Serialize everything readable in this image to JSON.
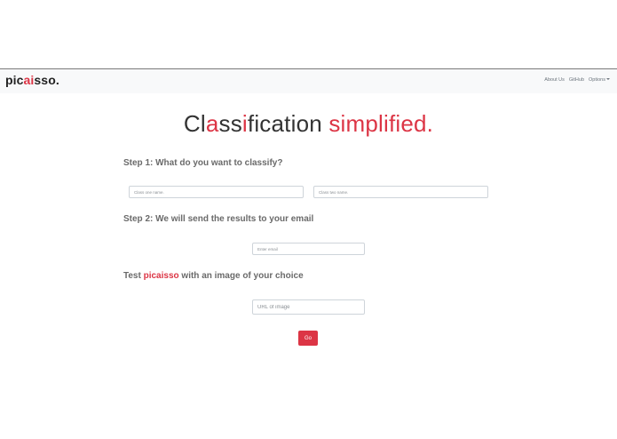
{
  "navbar": {
    "brand_prefix": "pic",
    "brand_accent": "ai",
    "brand_suffix": "sso.",
    "links": [
      "About Us",
      "GitHub",
      "Options"
    ]
  },
  "hero": {
    "title_part1": "Cl",
    "title_part2": "a",
    "title_part3": "ss",
    "title_part4": "i",
    "title_part5": "fication ",
    "title_accent": "simplified."
  },
  "step1": {
    "heading": "Step 1: What do you want to classify?",
    "class_one_placeholder": "Class one name.",
    "class_two_placeholder": "Class two name."
  },
  "step2": {
    "heading": "Step 2: We will send the results to your email",
    "email_placeholder": "Enter email"
  },
  "step3": {
    "heading_prefix": "Test ",
    "heading_accent": "picaisso",
    "heading_suffix": " with an image of your choice",
    "url_placeholder": "URL of image"
  },
  "go_label": "Go",
  "colors": {
    "accent": "#dc3545",
    "navbar_bg": "#f8f9fa"
  }
}
